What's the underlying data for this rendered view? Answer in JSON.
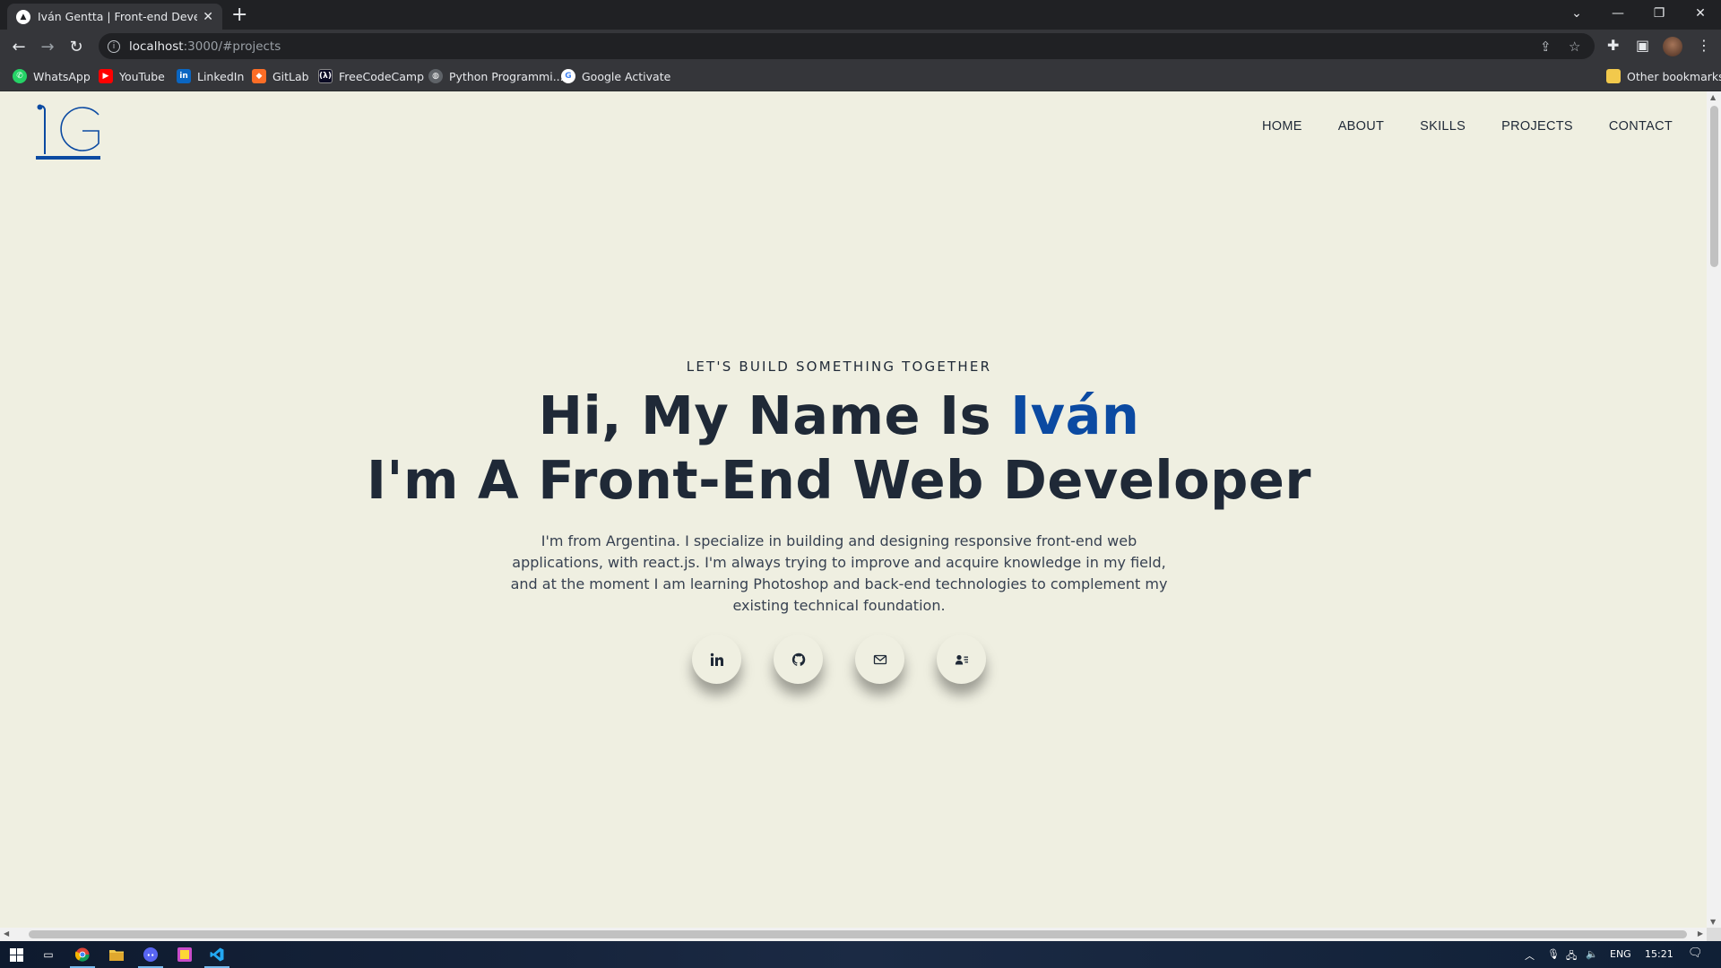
{
  "browser": {
    "tab_title": "Iván Gentta | Front-end Developer",
    "url_host": "localhost",
    "url_path": ":3000/#projects"
  },
  "bookmarks": [
    {
      "label": "WhatsApp",
      "icon": "whatsapp-icon",
      "color": "#25d366"
    },
    {
      "label": "YouTube",
      "icon": "youtube-icon",
      "color": "#ff0000"
    },
    {
      "label": "LinkedIn",
      "icon": "linkedin-icon",
      "color": "#0a66c2"
    },
    {
      "label": "GitLab",
      "icon": "gitlab-icon",
      "color": "#fc6d26"
    },
    {
      "label": "FreeCodeCamp",
      "icon": "freecodecamp-icon",
      "color": "#0a0a23"
    },
    {
      "label": "Python Programmi...",
      "icon": "python-icon",
      "color": "#5f6368"
    },
    {
      "label": "Google Activate",
      "icon": "google-icon",
      "color": "#ffffff"
    }
  ],
  "other_bookmarks": "Other bookmarks",
  "nav": [
    "HOME",
    "ABOUT",
    "SKILLS",
    "PROJECTS",
    "CONTACT"
  ],
  "hero": {
    "eyebrow": "LET'S BUILD SOMETHING TOGETHER",
    "line1_prefix": "Hi, My Name Is ",
    "line1_name": "Iván",
    "line2": "I'm A Front-End Web Developer",
    "description": "I'm from Argentina. I specialize in building and designing responsive front-end web applications, with react.js. I'm always trying to improve and acquire knowledge in my field, and at the moment I am learning Photoshop and back-end technologies to complement my existing technical foundation."
  },
  "socials": [
    "linkedin-icon",
    "github-icon",
    "mail-icon",
    "contact-card-icon"
  ],
  "colors": {
    "accent": "#0b4aa2",
    "page_bg": "#efefe1",
    "text": "#1f2937"
  },
  "taskbar": {
    "language": "ENG",
    "time": "15:21"
  }
}
